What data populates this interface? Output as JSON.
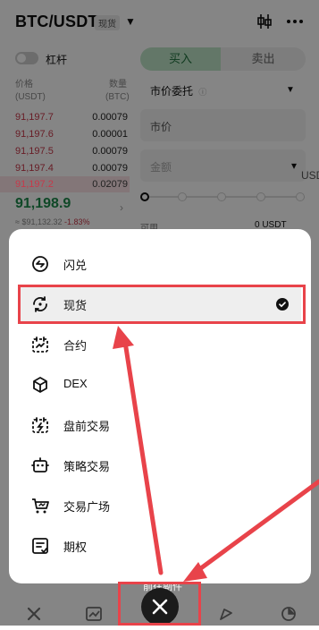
{
  "header": {
    "pair": "BTC/USDT",
    "badge": "现货"
  },
  "leverage": {
    "label": "杠杆"
  },
  "orderbook": {
    "col_price": [
      "价格",
      "(USDT)"
    ],
    "col_qty": [
      "数量",
      "(BTC)"
    ],
    "rows": [
      {
        "price": "91,197.7",
        "qty": "0.00079"
      },
      {
        "price": "91,197.6",
        "qty": "0.00001"
      },
      {
        "price": "91,197.5",
        "qty": "0.00079"
      },
      {
        "price": "91,197.4",
        "qty": "0.00079"
      },
      {
        "price": "91,197.2",
        "qty": "0.02079"
      }
    ],
    "last_price": "91,198.9",
    "last_usd": "≈ $91,132.32",
    "last_change": "-1.83%"
  },
  "trade": {
    "buy_label": "买入",
    "sell_label": "卖出",
    "order_type": "市价委托",
    "market_placeholder": "市价",
    "amount_placeholder": "金额",
    "amount_unit": "USDT",
    "available_label": "可用",
    "available_value": "0 USDT"
  },
  "menu": {
    "items": [
      {
        "label": "闪兑",
        "icon": "swap-icon",
        "selected": false
      },
      {
        "label": "现货",
        "icon": "spot-icon",
        "selected": true
      },
      {
        "label": "合约",
        "icon": "futures-icon",
        "selected": false
      },
      {
        "label": "DEX",
        "icon": "dex-cube-icon",
        "selected": false
      },
      {
        "label": "盘前交易",
        "icon": "premarket-icon",
        "selected": false
      },
      {
        "label": "策略交易",
        "icon": "bot-icon",
        "selected": false
      },
      {
        "label": "交易广场",
        "icon": "cart-icon",
        "selected": false
      },
      {
        "label": "期权",
        "icon": "options-icon",
        "selected": false
      }
    ]
  },
  "bottom": {
    "hint": "前往副件"
  },
  "colors": {
    "accent_red": "#e8434a",
    "buy_green": "#1e8a4c",
    "sell_red": "#c7394a"
  }
}
